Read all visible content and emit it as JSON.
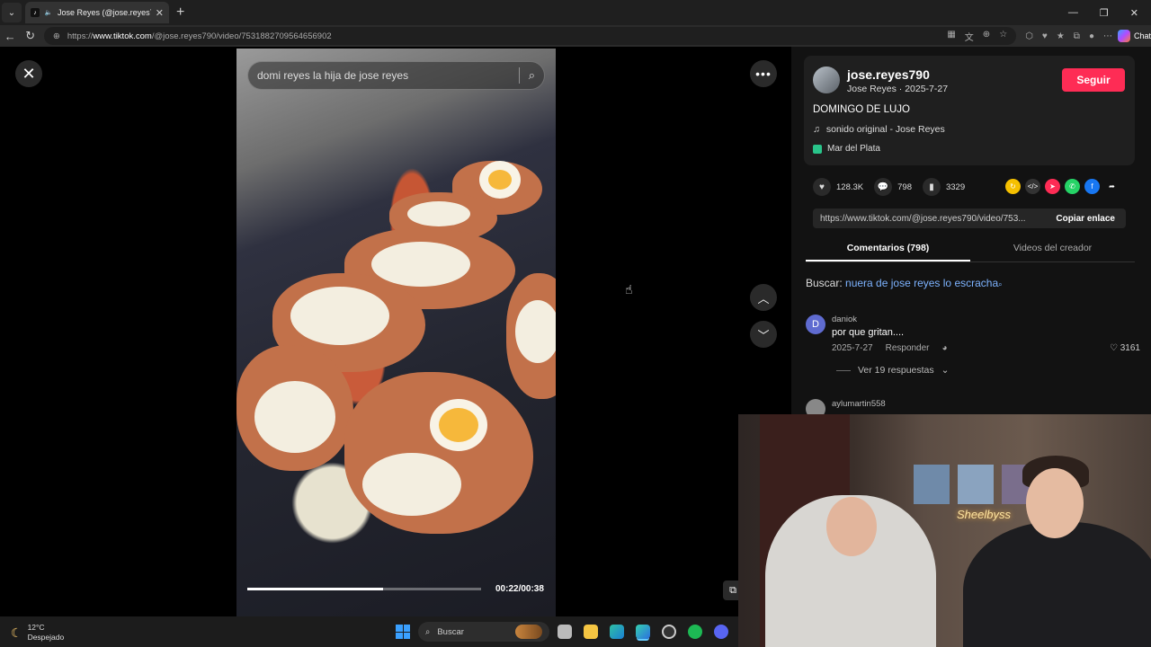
{
  "browser": {
    "tab_title": "Jose Reyes (@jose.reyes790) |",
    "url_prefix": "https://",
    "url_host": "www.tiktok.com",
    "url_path": "/@jose.reyes790/video/7531882709564656902",
    "chat_label": "Chat"
  },
  "video": {
    "search_text": "domi reyes la hija de jose reyes",
    "time": "00:22/00:38",
    "progress": 0.58
  },
  "creator": {
    "username": "jose.reyes790",
    "subline": "Jose Reyes · 2025-7-27",
    "follow_label": "Seguir",
    "caption": "DOMINGO DE LUJO",
    "music": "sonido original - Jose Reyes",
    "location": "Mar del Plata"
  },
  "stats": {
    "likes": "128.3K",
    "comments": "798",
    "saves": "3329"
  },
  "link": {
    "url": "https://www.tiktok.com/@jose.reyes790/video/753...",
    "copy_label": "Copiar enlace"
  },
  "tabs": {
    "comments": "Comentarios (798)",
    "creator_videos": "Videos del creador"
  },
  "search_suggest": {
    "label": "Buscar:",
    "query": "nuera de jose reyes lo escracha"
  },
  "comments": [
    {
      "avatar_letter": "D",
      "user": "daniok",
      "text": "por que gritan....",
      "date": "2025-7-27",
      "reply_label": "Responder",
      "likes": "3161",
      "replies_label": "Ver 19 respuestas"
    },
    {
      "user": "aylumartin558"
    }
  ],
  "cam": {
    "neon_text": "Sheelbyss"
  },
  "taskbar": {
    "temp": "12°C",
    "weather": "Despejado",
    "search": "Buscar"
  }
}
